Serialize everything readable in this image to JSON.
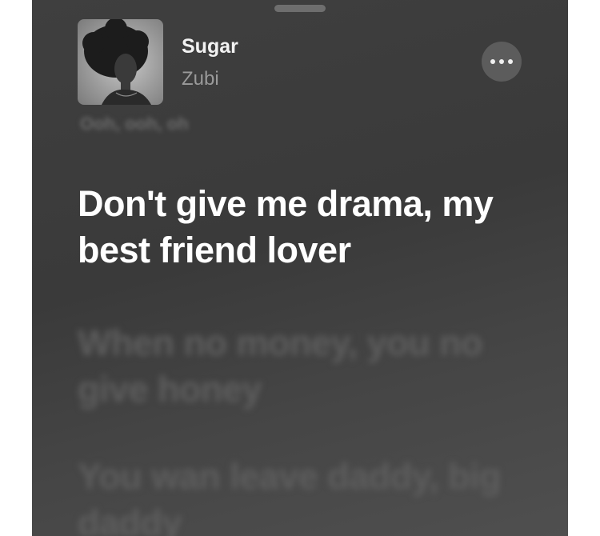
{
  "now_playing": {
    "title": "Sugar",
    "artist": "Zubi",
    "more_icon": "ellipsis-icon"
  },
  "lyrics": {
    "previous": "Ooh, ooh, oh",
    "active": "Don't give me drama, my best friend lover",
    "upcoming": [
      "When no money, you no give honey",
      "You wan leave daddy, big daddy"
    ]
  },
  "colors": {
    "background": "#3d3d3d",
    "active_text": "#ffffff",
    "inactive_text": "#5e5e5e",
    "artist_text": "#9a9a9a"
  }
}
